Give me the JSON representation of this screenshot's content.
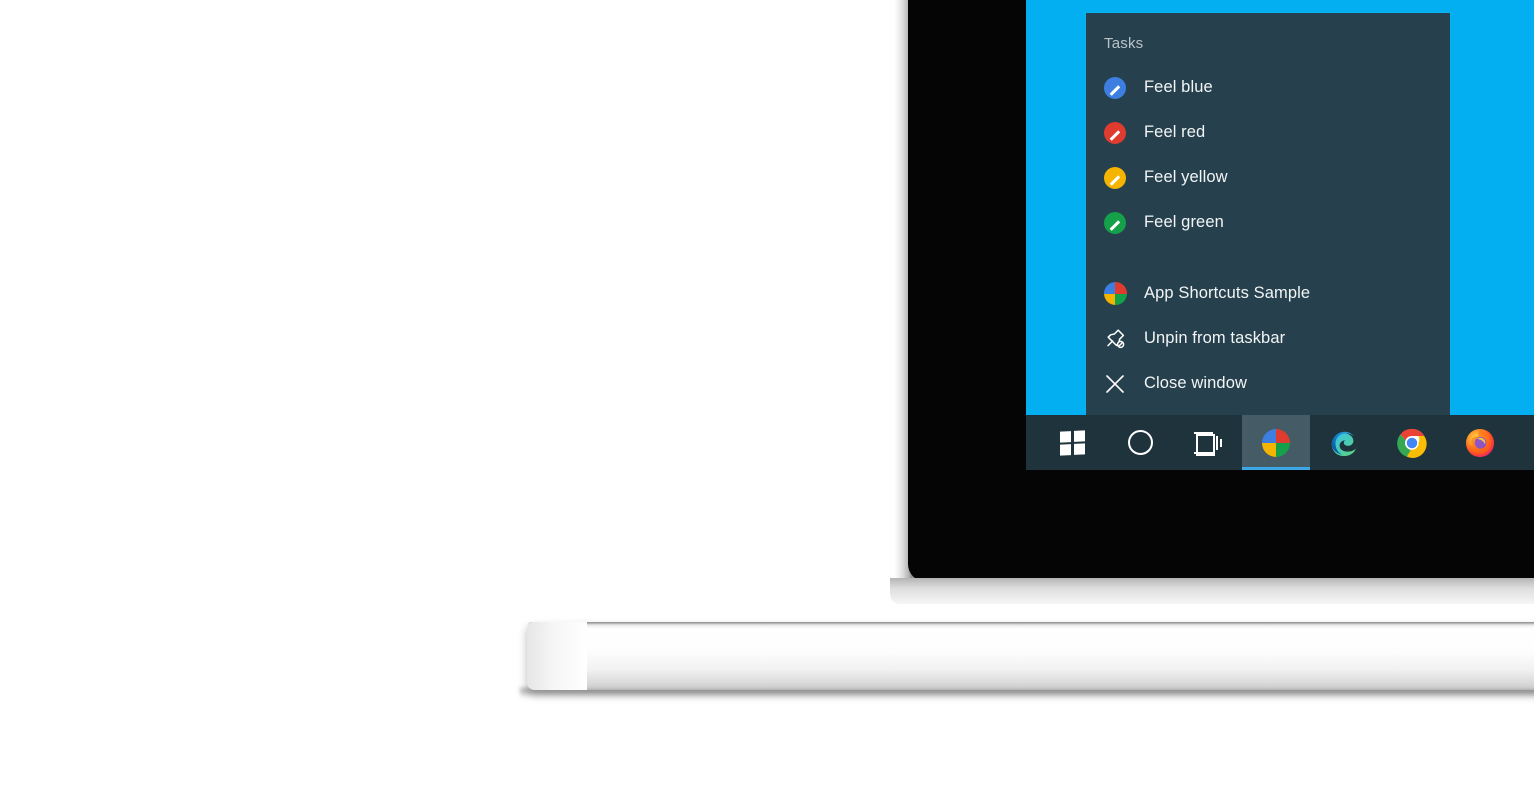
{
  "scene": {
    "device": "laptop",
    "colors": {
      "desktop_blue": "#03aff0",
      "taskbar_bg": "#1f333c",
      "jumplist_bg": "#26414d",
      "accent_underline": "#3ba9e8",
      "active_button_bg": "#455c66"
    }
  },
  "jumplist": {
    "header": "Tasks",
    "tasks": [
      {
        "label": "Feel blue",
        "icon": "pencil-circle-icon",
        "color": "#3d7fe0"
      },
      {
        "label": "Feel red",
        "icon": "pencil-circle-icon",
        "color": "#e03b2f"
      },
      {
        "label": "Feel yellow",
        "icon": "pencil-circle-icon",
        "color": "#f5b400"
      },
      {
        "label": "Feel green",
        "icon": "pencil-circle-icon",
        "color": "#15a04a"
      }
    ],
    "commands": [
      {
        "label": "App Shortcuts Sample",
        "icon": "app-pie-icon"
      },
      {
        "label": "Unpin from taskbar",
        "icon": "unpin-icon"
      },
      {
        "label": "Close window",
        "icon": "close-icon"
      }
    ],
    "app_icon_quadrants": {
      "top_left": "#3d7fe0",
      "top_right": "#e03b2f",
      "bottom_left": "#f5b400",
      "bottom_right": "#15a04a"
    }
  },
  "taskbar": {
    "buttons": [
      {
        "name": "start-button",
        "icon": "windows-logo-icon",
        "label": "Start",
        "active": false
      },
      {
        "name": "search-button",
        "icon": "search-ring-icon",
        "label": "Search",
        "active": false
      },
      {
        "name": "task-view-button",
        "icon": "task-view-icon",
        "label": "Task View",
        "active": false
      },
      {
        "name": "app-shortcuts-button",
        "icon": "app-pie-icon",
        "label": "App Shortcuts Sample",
        "active": true
      },
      {
        "name": "edge-button",
        "icon": "edge-icon",
        "label": "Microsoft Edge",
        "active": false
      },
      {
        "name": "chrome-button",
        "icon": "chrome-icon",
        "label": "Google Chrome",
        "active": false
      },
      {
        "name": "firefox-button",
        "icon": "firefox-icon",
        "label": "Mozilla Firefox",
        "active": false
      }
    ]
  }
}
